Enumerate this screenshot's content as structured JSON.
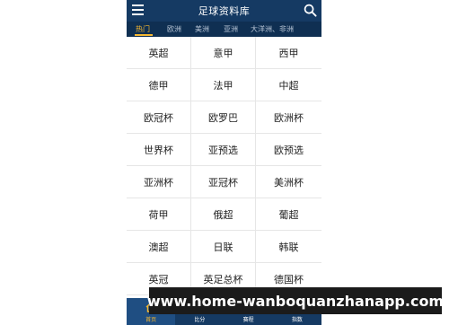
{
  "header": {
    "title": "足球资料库"
  },
  "tabs": [
    {
      "label": "热门",
      "active": true
    },
    {
      "label": "欧洲",
      "active": false
    },
    {
      "label": "美洲",
      "active": false
    },
    {
      "label": "亚洲",
      "active": false
    },
    {
      "label": "大洋洲、非洲",
      "active": false
    }
  ],
  "leagues": [
    "英超",
    "意甲",
    "西甲",
    "德甲",
    "法甲",
    "中超",
    "欧冠杯",
    "欧罗巴",
    "欧洲杯",
    "世界杯",
    "亚预选",
    "欧预选",
    "亚洲杯",
    "亚冠杯",
    "美洲杯",
    "荷甲",
    "俄超",
    "葡超",
    "澳超",
    "日联",
    "韩联",
    "英冠",
    "英足总杯",
    "德国杯"
  ],
  "bottom_nav": [
    {
      "label": "首页",
      "icon": "home-icon",
      "active": true
    },
    {
      "label": "比分",
      "icon": "score-icon",
      "active": false
    },
    {
      "label": "赛程",
      "icon": "schedule-icon",
      "active": false
    },
    {
      "label": "指数",
      "icon": "index-icon",
      "active": false
    }
  ],
  "watermark": "www.home-wanboquanzhanapp.com",
  "colors": {
    "header_bg": "#153a63",
    "tab_bg": "#0f2f52",
    "active_tab": "#f5b731",
    "grid_line": "#e6e6e6"
  }
}
